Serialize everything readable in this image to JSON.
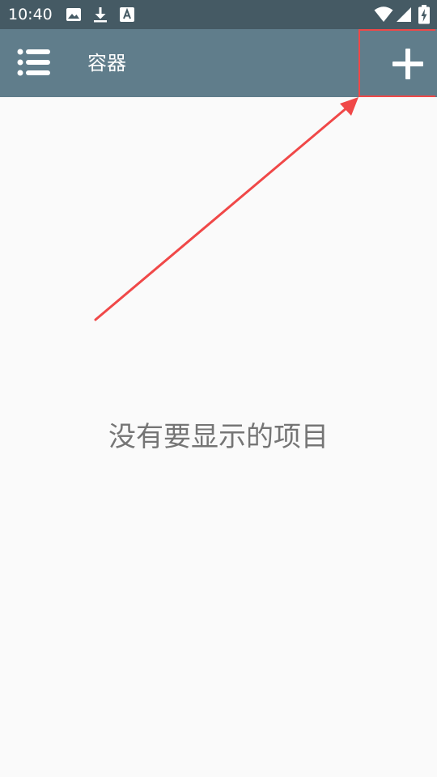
{
  "status_bar": {
    "time": "10:40",
    "icons": [
      "image-icon",
      "download-icon",
      "font-a-icon",
      "wifi-icon",
      "signal-icon",
      "battery-charging-icon"
    ]
  },
  "app_bar": {
    "title": "容器",
    "menu_icon": "list-menu-icon",
    "add_icon": "plus-icon"
  },
  "empty_state": {
    "message": "没有要显示的项目"
  },
  "colors": {
    "status_bar": "#455a64",
    "app_bar": "#607d8b",
    "background": "#fafafa",
    "annotation": "#f04848",
    "empty_text": "#757575"
  }
}
